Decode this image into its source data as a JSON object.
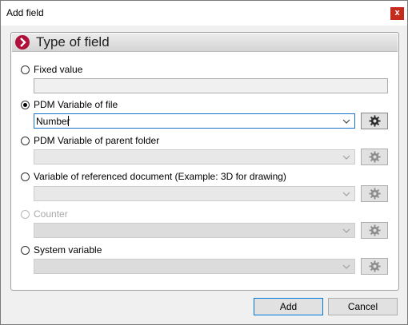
{
  "window": {
    "title": "Add field",
    "close_label": "x"
  },
  "group": {
    "title": "Type of field"
  },
  "options": {
    "fixed_value": {
      "label": "Fixed value",
      "checked": false,
      "value": ""
    },
    "pdm_file": {
      "label": "PDM Variable of file",
      "checked": true,
      "selected": "Number"
    },
    "pdm_parent": {
      "label": "PDM Variable of parent folder",
      "checked": false,
      "selected": ""
    },
    "referenced": {
      "label": "Variable of referenced document (Example: 3D for drawing)",
      "checked": false,
      "selected": ""
    },
    "counter": {
      "label": "Counter",
      "checked": false,
      "disabled": true,
      "selected": ""
    },
    "system": {
      "label": "System variable",
      "checked": false,
      "selected": ""
    }
  },
  "buttons": {
    "add": "Add",
    "cancel": "Cancel"
  },
  "icons": {
    "header": "chevron-right-icon",
    "settings": "gear-icon",
    "dropdown": "chevron-down-icon"
  },
  "colors": {
    "accent": "#b0103a",
    "focus_border": "#1a73c8",
    "close_bg": "#c42b1c"
  }
}
